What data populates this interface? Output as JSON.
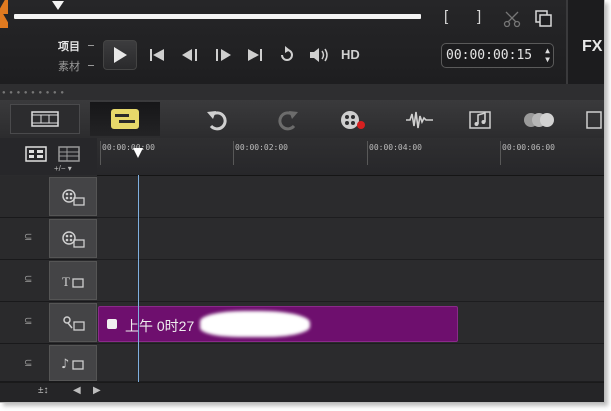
{
  "player": {
    "mode_project": "项目",
    "mode_clip": "素材",
    "mark_in_symbol": "[",
    "mark_out_symbol": "]",
    "hd_label": "HD",
    "timecode": "00:00:00:15",
    "fx_label": "FX"
  },
  "ruler": {
    "ticks": [
      "00:00:00:00",
      "00:00:02:00",
      "00:00:04:00",
      "00:00:06:00"
    ]
  },
  "tracks": [
    {
      "icon": "video-track-icon"
    },
    {
      "icon": "overlay-track-icon"
    },
    {
      "icon": "title-track-icon"
    },
    {
      "icon": "voice-track-icon"
    },
    {
      "icon": "music-track-icon"
    }
  ],
  "clip": {
    "label": "上午 0时27",
    "color": "#6e0f6e"
  },
  "colors": {
    "accent_trim": "#e07a20",
    "playhead": "#7fb0e0",
    "active_view": "#e6d86a"
  }
}
